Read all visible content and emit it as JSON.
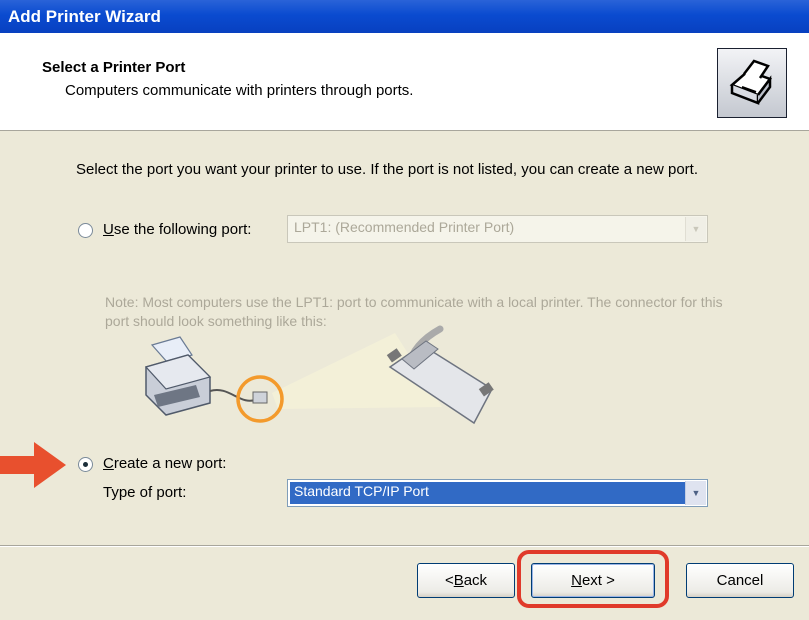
{
  "window": {
    "title": "Add Printer Wizard"
  },
  "header": {
    "title": "Select a Printer Port",
    "subtitle": "Computers communicate with printers through ports.",
    "icon": "printer-icon"
  },
  "body": {
    "intro": "Select the port you want your printer to use.  If the port is not listed, you can create a new port.",
    "use_following_port": {
      "label_accel": "U",
      "label_rest": "se the following port:",
      "value": "LPT1: (Recommended Printer Port)",
      "checked": false,
      "enabled": false
    },
    "note": "Note: Most computers use the LPT1: port to communicate with a local printer. The connector for this port should look something like this:",
    "create_new_port": {
      "label_accel": "C",
      "label_rest": "reate a new port:",
      "checked": true
    },
    "type_of_port": {
      "label": "Type of port:",
      "value": "Standard TCP/IP Port"
    }
  },
  "buttons": {
    "back": {
      "prefix": "< ",
      "accel": "B",
      "rest": "ack"
    },
    "next": {
      "accel": "N",
      "rest": "ext >"
    },
    "cancel": "Cancel"
  },
  "colors": {
    "title_bar": "#0a4bd0",
    "dialog_bg": "#ece9d8",
    "annotation_red": "#e03a2a",
    "selection_blue": "#316ac5"
  }
}
